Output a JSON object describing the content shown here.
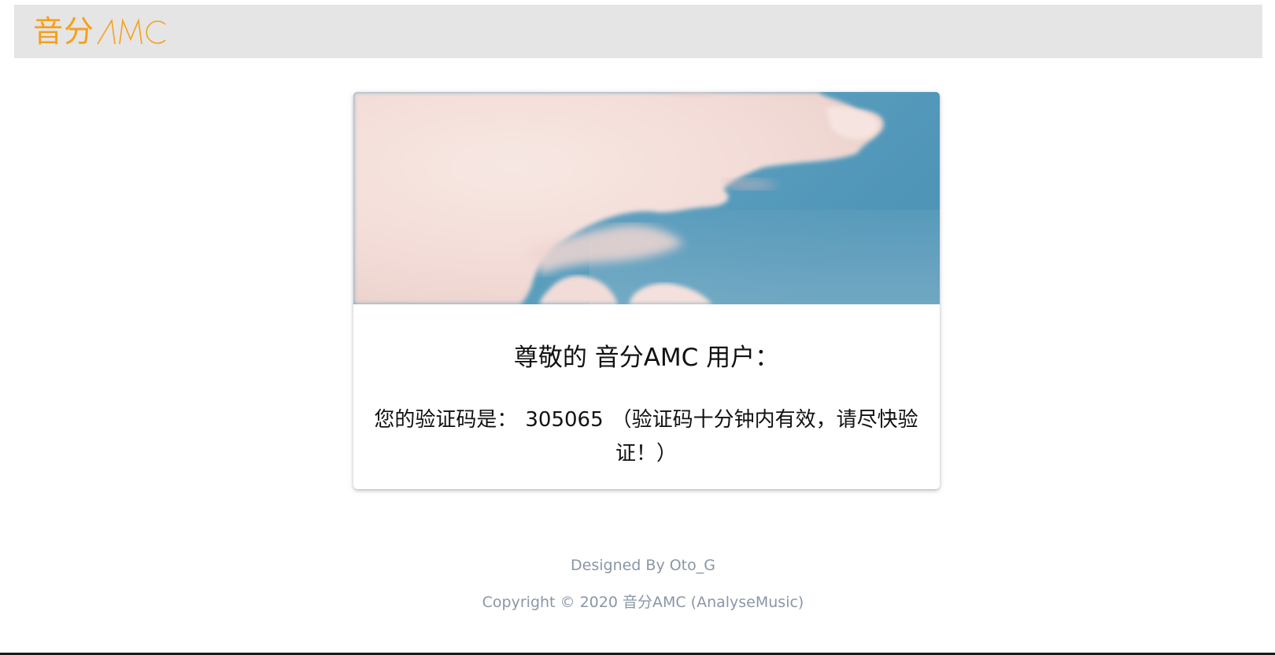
{
  "header": {
    "logo_cn": "音分",
    "logo_en": "AMC",
    "brand_color": "#f5a01a",
    "background": "#e5e5e5"
  },
  "card": {
    "hero_image": "sky-with-clouds",
    "greeting": "尊敬的 音分AMC 用户：",
    "message_prefix": "您的验证码是：",
    "code": "305065",
    "message_suffix": "（验证码十分钟内有效，请尽快验证！）"
  },
  "footer": {
    "designed_by": "Designed By Oto_G",
    "copyright": "Copyright © 2020 音分AMC (AnalyseMusic)",
    "text_color": "#8a96a6"
  }
}
